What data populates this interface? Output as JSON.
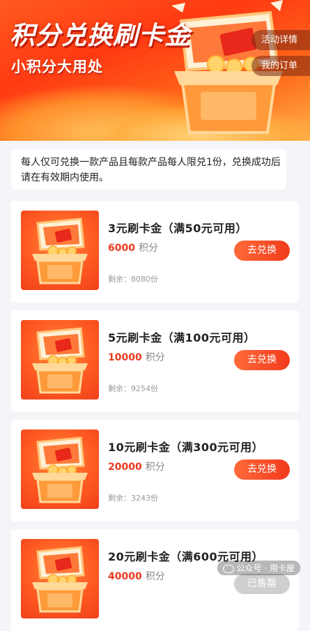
{
  "banner": {
    "title": "积分兑换刷卡金",
    "subtitle": "小积分大用处",
    "activity_details": "活动详情",
    "my_orders": "我的订单"
  },
  "notice": {
    "text": "每人仅可兑换一款产品且每款产品每人限兑1份，兑换成功后请在有效期内使用。"
  },
  "products": [
    {
      "name": "3元刷卡金（满50元可用）",
      "points": "6000",
      "points_unit": "积分",
      "remaining": "剩余：8080份",
      "button": "去兑换"
    },
    {
      "name": "5元刷卡金（满100元可用）",
      "points": "10000",
      "points_unit": "积分",
      "remaining": "剩余：9254份",
      "button": "去兑换"
    },
    {
      "name": "10元刷卡金（满300元可用）",
      "points": "20000",
      "points_unit": "积分",
      "remaining": "剩余：3243份",
      "button": "去兑换"
    },
    {
      "name": "20元刷卡金（满600元可用）",
      "points": "40000",
      "points_unit": "积分",
      "remaining": "",
      "button": "已售罄"
    }
  ],
  "watermark": "公众号 · 用卡屋",
  "colors": {
    "accent": "#f23a1c",
    "price": "#ea3a1f",
    "banner": "#ff4a1a"
  }
}
